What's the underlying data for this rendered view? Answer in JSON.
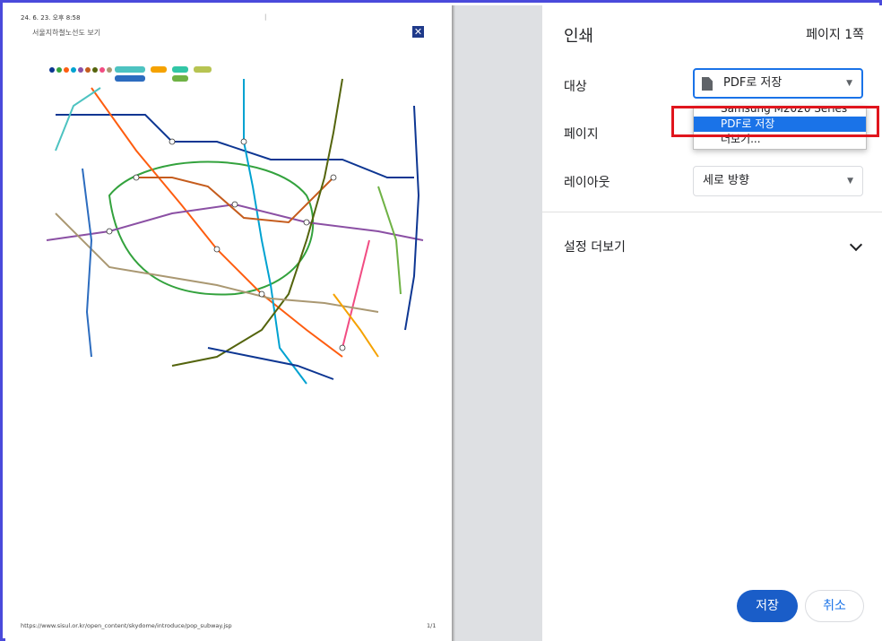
{
  "preview": {
    "header_date": "24. 6. 23. 오후 8:58",
    "header_title": "서울지하철노선도 보기",
    "footer_url": "https://www.sisul.or.kr/open_content/skydome/introduce/pop_subway.jsp",
    "footer_page": "1/1"
  },
  "panel": {
    "title": "인쇄",
    "page_count": "페이지 1쪽",
    "destination_label": "대상",
    "destination_value": "PDF로 저장",
    "pages_label": "페이지",
    "layout_label": "레이아웃",
    "layout_value": "세로 방향",
    "more_settings": "설정 더보기",
    "save_button": "저장",
    "cancel_button": "취소"
  },
  "dropdown": {
    "options": [
      "Samsung M2020 Series",
      "PDF로 저장",
      "더보기..."
    ],
    "selected_index": 1
  },
  "colors": {
    "frame": "#4a4adb",
    "accent": "#1a73e8",
    "highlight": "#e0151d"
  }
}
